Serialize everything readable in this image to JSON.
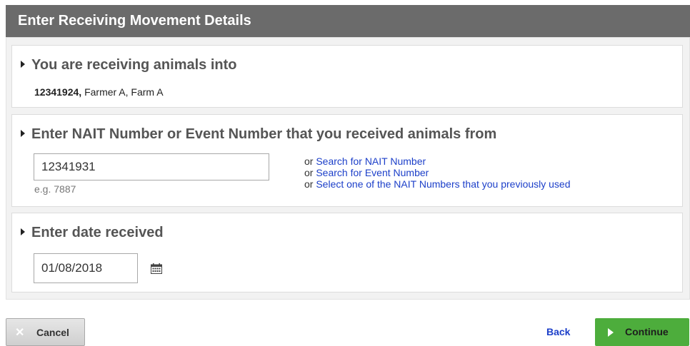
{
  "header": {
    "title": "Enter Receiving Movement Details"
  },
  "receiving": {
    "heading": "You are receiving animals into",
    "nait_number": "12341924,",
    "farm": "Farmer A, Farm A"
  },
  "source": {
    "heading": "Enter NAIT Number or Event Number that you received animals from",
    "input_value": "12341931",
    "hint": "e.g. 7887",
    "or_label": "or",
    "link_search_nait": "Search for NAIT Number",
    "link_search_event": "Search for Event Number",
    "link_select_previous": "Select one of the NAIT Numbers that you previously used"
  },
  "date": {
    "heading": "Enter date received",
    "value": "01/08/2018",
    "icon": "calendar-icon"
  },
  "actions": {
    "cancel_label": "Cancel",
    "back_label": "Back",
    "continue_label": "Continue"
  },
  "colors": {
    "header_bg": "#6b6b6b",
    "link": "#1c3fc9",
    "continue_bg": "#4dad3c"
  }
}
